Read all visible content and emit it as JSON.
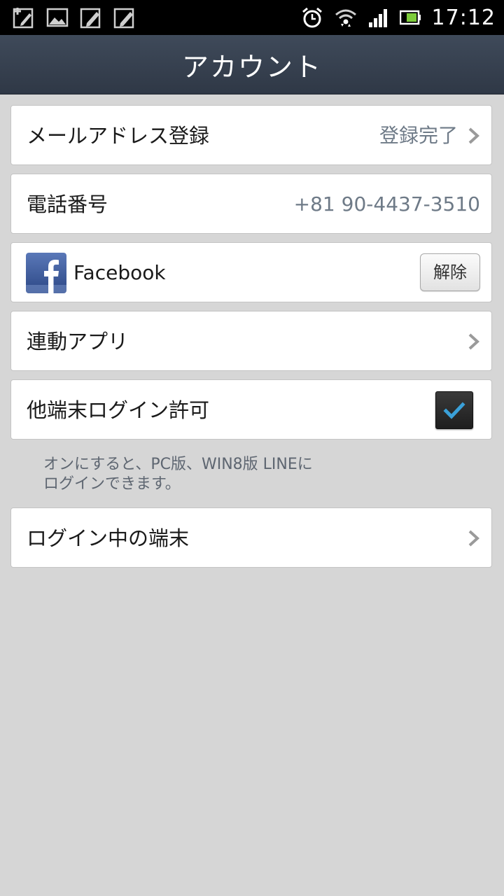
{
  "status_bar": {
    "time": "17:12",
    "notification_icons": [
      "add-note-icon",
      "image-icon",
      "edit-icon",
      "edit-icon"
    ],
    "system_icons": [
      "alarm-icon",
      "wifi-icon",
      "signal-icon",
      "battery-icon"
    ]
  },
  "header": {
    "title": "アカウント"
  },
  "settings": {
    "email": {
      "label": "メールアドレス登録",
      "value": "登録完了"
    },
    "phone": {
      "label": "電話番号",
      "value": "+81 90-4437-3510"
    },
    "facebook": {
      "label": "Facebook",
      "button_label": "解除"
    },
    "linked_apps": {
      "label": "連動アプリ"
    },
    "other_device_login": {
      "label": "他端末ログイン許可",
      "checked": true,
      "help_line1": "オンにすると、PC版、WIN8版 LINEに",
      "help_line2": "ログインできます。"
    },
    "logged_in_devices": {
      "label": "ログイン中の端末"
    }
  },
  "colors": {
    "header_bg": "#36404e",
    "page_bg": "#d6d6d6",
    "value_text": "#6e7a87",
    "check_blue": "#3aa0d8",
    "facebook_blue": "#3b5998"
  }
}
